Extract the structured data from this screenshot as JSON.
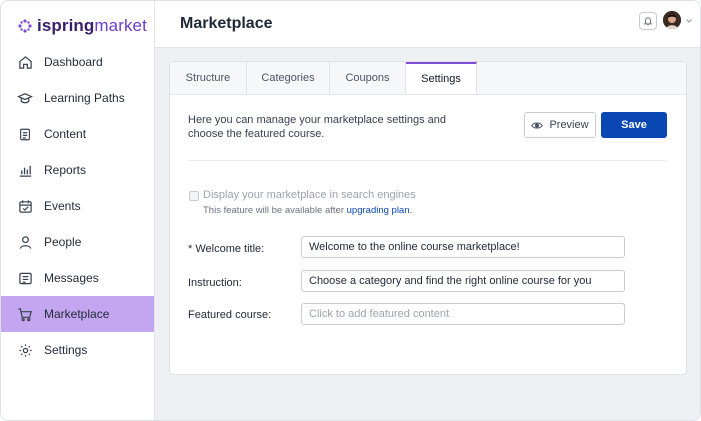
{
  "brand": {
    "part1": "ispring",
    "part2": "market"
  },
  "sidebar": {
    "items": [
      {
        "label": "Dashboard",
        "icon": "home-icon"
      },
      {
        "label": "Learning Paths",
        "icon": "graduation-cap-icon"
      },
      {
        "label": "Content",
        "icon": "content-icon"
      },
      {
        "label": "Reports",
        "icon": "bar-chart-icon"
      },
      {
        "label": "Events",
        "icon": "calendar-icon"
      },
      {
        "label": "People",
        "icon": "person-icon"
      },
      {
        "label": "Messages",
        "icon": "message-icon"
      },
      {
        "label": "Marketplace",
        "icon": "cart-icon",
        "active": true
      },
      {
        "label": "Settings",
        "icon": "gear-icon"
      }
    ]
  },
  "header": {
    "title": "Marketplace"
  },
  "tabs": [
    {
      "label": "Structure"
    },
    {
      "label": "Categories"
    },
    {
      "label": "Coupons"
    },
    {
      "label": "Settings",
      "active": true
    }
  ],
  "settings": {
    "description": "Here you can manage your marketplace settings and choose the featured course.",
    "preview_label": "Preview",
    "save_label": "Save",
    "search_checkbox_label": "Display your marketplace in search engines",
    "search_note_prefix": "This feature will be available after ",
    "search_note_link": "upgrading plan",
    "search_note_suffix": ".",
    "welcome_label": "* Welcome title:",
    "welcome_value": "Welcome to the online course marketplace!",
    "instruction_label": "Instruction:",
    "instruction_value": "Choose a category and find the right online course for you",
    "featured_label": "Featured course:",
    "featured_placeholder": "Click to add featured content"
  },
  "colors": {
    "accent": "#7c4dd8",
    "active_nav": "#c3a6ef",
    "primary_button": "#0a47b3"
  }
}
